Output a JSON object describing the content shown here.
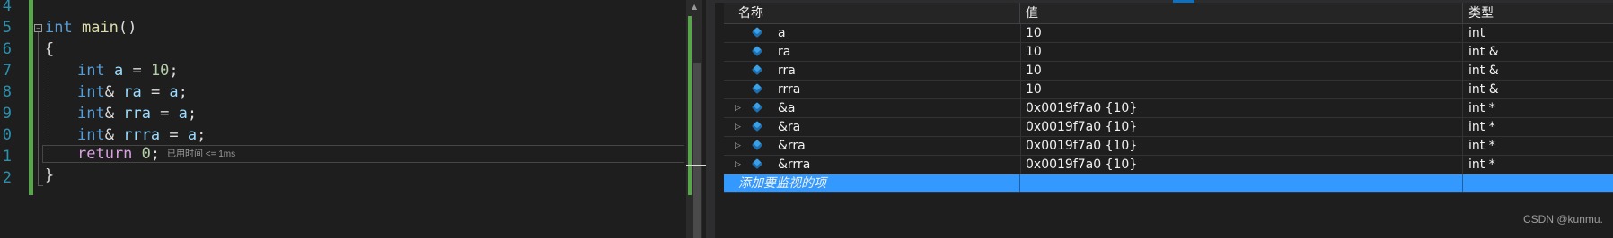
{
  "editor": {
    "line_numbers": [
      "4",
      "5",
      "6",
      "7",
      "8",
      "9",
      "0",
      "1",
      "2"
    ],
    "code": {
      "l5": {
        "kw": "int",
        "fn": "main",
        "rest": "()"
      },
      "l6": "{",
      "l7": {
        "kw": "int",
        "var": "a",
        "op": " = ",
        "num": "10",
        "end": ";"
      },
      "l8": {
        "kw": "int",
        "amp": "&",
        "var": "ra",
        "op": " = ",
        "rhs": "a",
        "end": ";"
      },
      "l9": {
        "kw": "int",
        "amp": "&",
        "var": "rra",
        "op": " = ",
        "rhs": "a",
        "end": ";"
      },
      "l10": {
        "kw": "int",
        "amp": "&",
        "var": "rrra",
        "op": " = ",
        "rhs": "a",
        "end": ";"
      },
      "l11": {
        "kw": "return",
        "num": "0",
        "end": ";"
      },
      "l12": "}"
    },
    "elapsed_hint": "已用时间 <= 1ms",
    "colors": {
      "change_bar": "#57a64a",
      "keyword": "#569cd6",
      "return_keyword": "#d8a0df"
    }
  },
  "watch": {
    "columns": {
      "name": "名称",
      "value": "值",
      "type": "类型"
    },
    "rows": [
      {
        "name": "a",
        "value": "10",
        "type": "int",
        "expandable": false
      },
      {
        "name": "ra",
        "value": "10",
        "type": "int &",
        "expandable": false
      },
      {
        "name": "rra",
        "value": "10",
        "type": "int &",
        "expandable": false
      },
      {
        "name": "rrra",
        "value": "10",
        "type": "int &",
        "expandable": false
      },
      {
        "name": "&a",
        "value": "0x0019f7a0 {10}",
        "type": "int *",
        "expandable": true
      },
      {
        "name": "&ra",
        "value": "0x0019f7a0 {10}",
        "type": "int *",
        "expandable": true
      },
      {
        "name": "&rra",
        "value": "0x0019f7a0 {10}",
        "type": "int *",
        "expandable": true
      },
      {
        "name": "&rrra",
        "value": "0x0019f7a0 {10}",
        "type": "int *",
        "expandable": true
      }
    ],
    "add_item_placeholder": "添加要监视的项",
    "icons": {
      "variable": "variable-cube-icon",
      "expander": "expand-arrow-icon"
    },
    "colors": {
      "selection": "#3399ff",
      "header_bg": "#252526",
      "variable_icon": "#3ba0e6"
    }
  },
  "watermark": "CSDN @kunmu."
}
